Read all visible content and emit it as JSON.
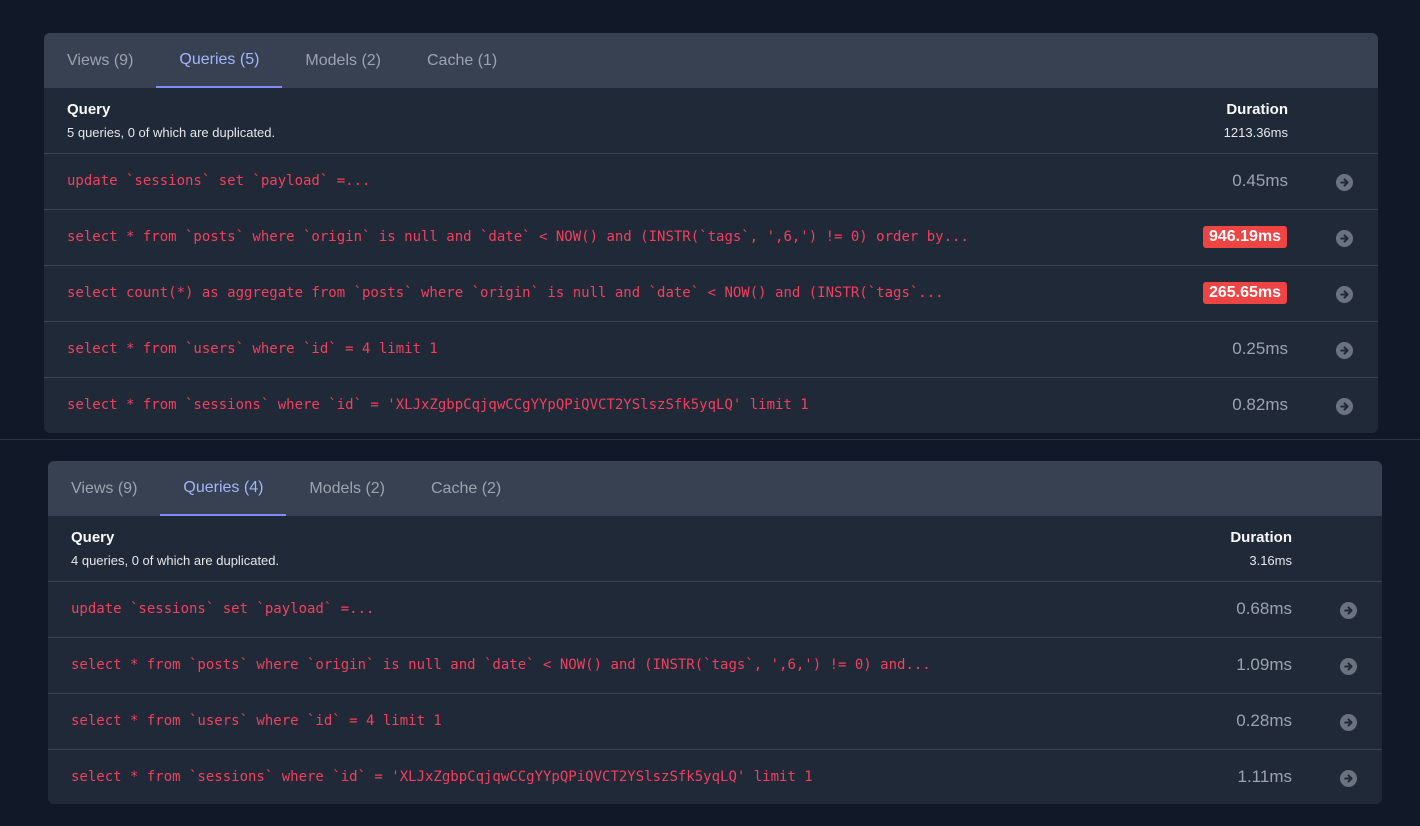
{
  "panels": [
    {
      "tabs": [
        {
          "label": "Views (9)",
          "active": false
        },
        {
          "label": "Queries (5)",
          "active": true
        },
        {
          "label": "Models (2)",
          "active": false
        },
        {
          "label": "Cache (1)",
          "active": false
        }
      ],
      "header": {
        "title": "Query",
        "subtitle": "5 queries, 0 of which are duplicated.",
        "duration_label": "Duration",
        "total": "1213.36ms"
      },
      "rows": [
        {
          "sql": "update `sessions` set `payload` =...",
          "duration": "0.45ms",
          "slow": false
        },
        {
          "sql": "select * from `posts` where `origin` is null and `date` < NOW() and (INSTR(`tags`, ',6,') != 0) order by...",
          "duration": "946.19ms",
          "slow": true
        },
        {
          "sql": "select count(*) as aggregate from `posts` where `origin` is null and `date` < NOW() and (INSTR(`tags`...",
          "duration": "265.65ms",
          "slow": true
        },
        {
          "sql": "select * from `users` where `id` = 4 limit 1",
          "duration": "0.25ms",
          "slow": false
        },
        {
          "sql": "select * from `sessions` where `id` = 'XLJxZgbpCqjqwCCgYYpQPiQVCT2YSlszSfk5yqLQ' limit 1",
          "duration": "0.82ms",
          "slow": false
        }
      ]
    },
    {
      "tabs": [
        {
          "label": "Views (9)",
          "active": false
        },
        {
          "label": "Queries (4)",
          "active": true
        },
        {
          "label": "Models (2)",
          "active": false
        },
        {
          "label": "Cache (2)",
          "active": false
        }
      ],
      "header": {
        "title": "Query",
        "subtitle": "4 queries, 0 of which are duplicated.",
        "duration_label": "Duration",
        "total": "3.16ms"
      },
      "rows": [
        {
          "sql": "update `sessions` set `payload` =...",
          "duration": "0.68ms",
          "slow": false
        },
        {
          "sql": "select * from `posts` where `origin` is null and `date` < NOW() and (INSTR(`tags`, ',6,') != 0) and...",
          "duration": "1.09ms",
          "slow": false
        },
        {
          "sql": "select * from `users` where `id` = 4 limit 1",
          "duration": "0.28ms",
          "slow": false
        },
        {
          "sql": "select * from `sessions` where `id` = 'XLJxZgbpCqjqwCCgYYpQPiQVCT2YSlszSfk5yqLQ' limit 1",
          "duration": "1.11ms",
          "slow": false
        }
      ]
    }
  ],
  "icons": {
    "row_action": "arrow-right-circle-icon"
  },
  "colors": {
    "background": "#111827",
    "panel": "#1f2937",
    "tab_bar": "#374151",
    "active_tab": "#a5b4fc",
    "sql_text": "#f43f5e",
    "slow_badge": "#ef4444"
  }
}
